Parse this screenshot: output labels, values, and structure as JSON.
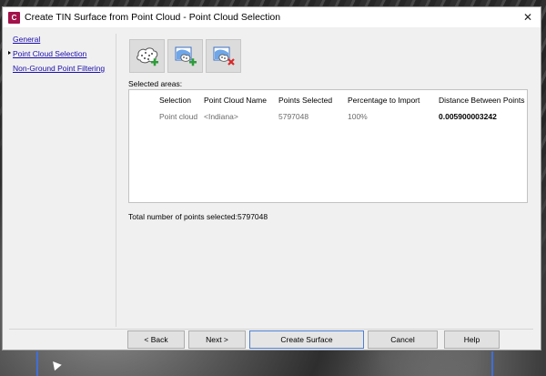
{
  "window": {
    "title": "Create TIN Surface from Point Cloud - Point Cloud Selection",
    "app_icon_letter": "C",
    "close_glyph": "✕"
  },
  "nav": {
    "items": [
      {
        "label": "General",
        "active": false
      },
      {
        "label": "Point Cloud Selection",
        "active": true
      },
      {
        "label": "Non-Ground Point Filtering",
        "active": false
      }
    ]
  },
  "toolbar": {
    "buttons": [
      {
        "icon": "add-point-cloud-icon"
      },
      {
        "icon": "add-area-icon"
      },
      {
        "icon": "remove-area-icon"
      }
    ]
  },
  "selection": {
    "label": "Selected areas:",
    "columns": [
      "Selection",
      "Point Cloud Name",
      "Points Selected",
      "Percentage to Import",
      "Distance Between Points"
    ],
    "rows": [
      [
        "Point cloud",
        "<Indiana>",
        "5797048",
        "100%",
        "0.005900003242"
      ]
    ]
  },
  "total": {
    "label": "Total number of points selected:",
    "value": "5797048"
  },
  "footer": {
    "back_label": "< Back",
    "next_label": "Next >",
    "create_label": "Create Surface",
    "cancel_label": "Cancel",
    "help_label": "Help"
  },
  "colors": {
    "accent": "#4d7fd6",
    "app_icon": "#a3124a",
    "link": "#1a0dab"
  }
}
